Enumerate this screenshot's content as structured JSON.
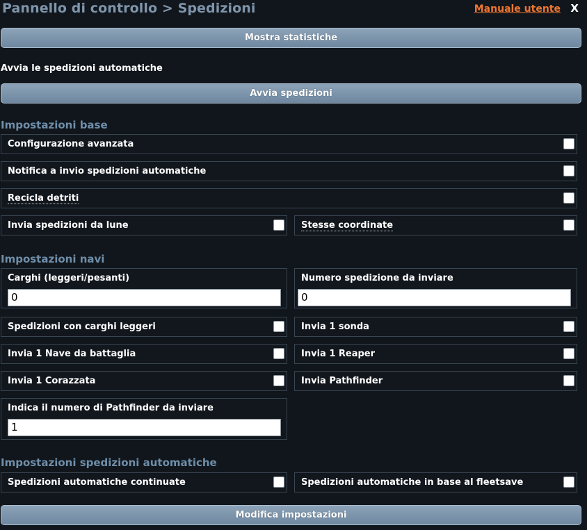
{
  "header": {
    "title": "Pannello di controllo > Spedizioni",
    "manual_link": "Manuale utente",
    "close_label": "X"
  },
  "buttons": {
    "show_stats": "Mostra statistiche",
    "start_expeditions": "Avvia spedizioni",
    "modify_settings": "Modifica impostazioni"
  },
  "intro_text": "Avvia le spedizioni automatiche",
  "sections": {
    "base": {
      "title": "Impostazioni base",
      "advanced_config": "Configurazione avanzata",
      "notify_auto": "Notifica a invio spedizioni automatiche",
      "recycle_debris": "Recicla detriti",
      "from_moons": "Invia spedizioni da lune",
      "same_coords": "Stesse coordinate"
    },
    "ships": {
      "title": "Impostazioni navi",
      "cargo_label": "Carghi (leggeri/pesanti)",
      "cargo_value": "0",
      "expedition_count_label": "Numero spedizione da inviare",
      "expedition_count_value": "0",
      "light_cargo": "Spedizioni con carghi leggeri",
      "send_probe": "Invia 1 sonda",
      "send_battleship": "Invia 1 Nave da battaglia",
      "send_reaper": "Invia 1 Reaper",
      "send_cruiser": "Invia 1 Corazzata",
      "send_pathfinder": "Invia Pathfinder",
      "pathfinder_count_label": "Indica il numero di Pathfinder da inviare",
      "pathfinder_count_value": "1"
    },
    "auto": {
      "title": "Impostazioni spedizioni automatiche",
      "continuous": "Spedizioni automatiche continuate",
      "fleetsave": "Spedizioni automatiche in base al fleetsave"
    }
  },
  "colors": {
    "background": "#11161c",
    "title": "#7f95ab",
    "section_title": "#6f8ea9",
    "link": "#ee7630",
    "button": "#7d95ab"
  }
}
